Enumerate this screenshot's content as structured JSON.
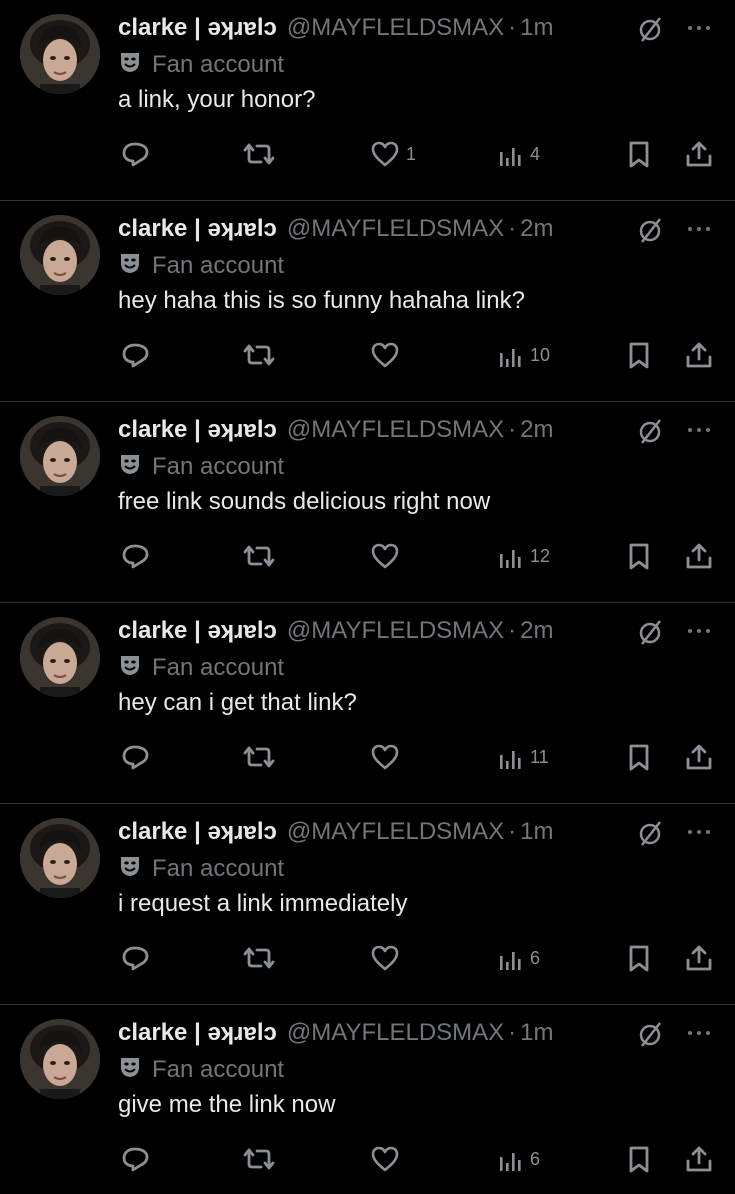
{
  "colors": {
    "background": "#000000",
    "primary_text": "#e7e9ea",
    "secondary_text": "#71767b",
    "divider": "#2f3336"
  },
  "icons": {
    "label_badge": "theater-mask-icon",
    "muted": "circle-slash-icon",
    "more": "more-dots-icon",
    "reply": "reply-icon",
    "retweet": "retweet-icon",
    "like": "heart-icon",
    "views": "views-bar-chart-icon",
    "bookmark": "bookmark-icon",
    "share": "share-icon"
  },
  "tweets": [
    {
      "display_name": "clarke | ǝʞɹɐlɔ",
      "handle": "@MAYFLELDSMAX",
      "time": "1m",
      "label": "Fan account",
      "text": "a link, your honor?",
      "likes": "1",
      "views": "4"
    },
    {
      "display_name": "clarke | ǝʞɹɐlɔ",
      "handle": "@MAYFLELDSMAX",
      "time": "2m",
      "label": "Fan account",
      "text": "hey haha this is so funny hahaha link?",
      "likes": "",
      "views": "10"
    },
    {
      "display_name": "clarke | ǝʞɹɐlɔ",
      "handle": "@MAYFLELDSMAX",
      "time": "2m",
      "label": "Fan account",
      "text": "free link sounds delicious right now",
      "likes": "",
      "views": "12"
    },
    {
      "display_name": "clarke | ǝʞɹɐlɔ",
      "handle": "@MAYFLELDSMAX",
      "time": "2m",
      "label": "Fan account",
      "text": "hey can i get that link?",
      "likes": "",
      "views": "11"
    },
    {
      "display_name": "clarke | ǝʞɹɐlɔ",
      "handle": "@MAYFLELDSMAX",
      "time": "1m",
      "label": "Fan account",
      "text": "i request a link immediately",
      "likes": "",
      "views": "6"
    },
    {
      "display_name": "clarke | ǝʞɹɐlɔ",
      "handle": "@MAYFLELDSMAX",
      "time": "1m",
      "label": "Fan account",
      "text": "give me the link now",
      "likes": "",
      "views": "6"
    }
  ]
}
